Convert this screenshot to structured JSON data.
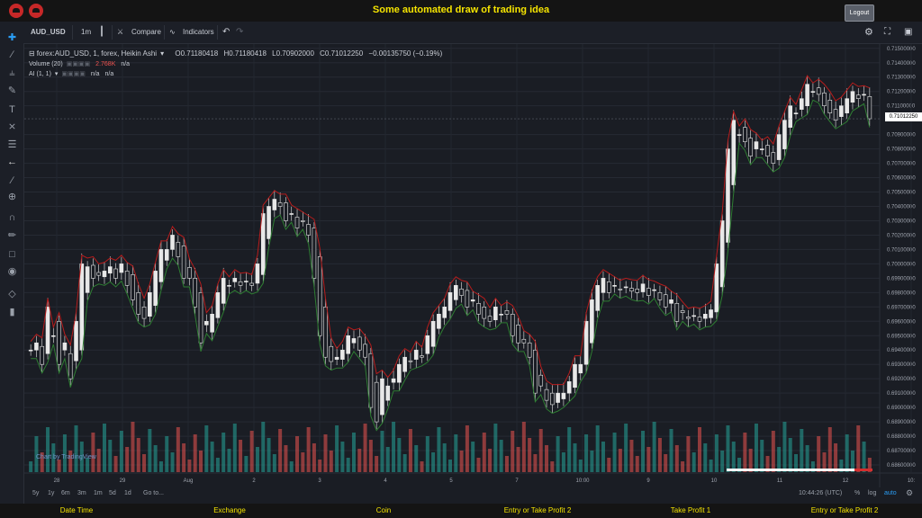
{
  "header": {
    "title": "Some automated draw of trading idea",
    "logout_label": "Logout"
  },
  "toolbar": {
    "symbol": "AUD_USD",
    "interval": "1m",
    "compare_label": "Compare",
    "indicators_label": "Indicators"
  },
  "legend": {
    "main_title": "forex:AUD_USD, 1, forex, Heikin Ashi",
    "open": "O0.71180418",
    "high": "H0.71180418",
    "low": "L0.70902000",
    "close": "C0.71012250",
    "change": "−0.00135750 (−0.19%)",
    "volume_label": "Volume (20)",
    "volume_value": "2.768K",
    "volume_na": "n/a",
    "ai_label": "AI (1, 1)",
    "ai_na1": "n/a",
    "ai_na2": "n/a"
  },
  "price_axis": {
    "ticks": [
      "0.71500000",
      "0.71400000",
      "0.71300000",
      "0.71200000",
      "0.71100000",
      "0.70900000",
      "0.70800000",
      "0.70700000",
      "0.70600000",
      "0.70500000",
      "0.70400000",
      "0.70300000",
      "0.70200000",
      "0.70100000",
      "0.70000000",
      "0.69900000",
      "0.69800000",
      "0.69700000",
      "0.69600000",
      "0.69500000",
      "0.69400000",
      "0.69300000",
      "0.69200000",
      "0.69100000",
      "0.69000000",
      "0.68900000",
      "0.68800000",
      "0.68700000",
      "0.68600000"
    ],
    "current_price": "0.71012250"
  },
  "time_axis": {
    "labels": [
      "28",
      "29",
      "Aug",
      "2",
      "3",
      "4",
      "5",
      "7",
      "10:00",
      "9",
      "10",
      "11",
      "12",
      "10:"
    ]
  },
  "timebar": {
    "ranges": [
      "5y",
      "1y",
      "6m",
      "3m",
      "1m",
      "5d",
      "1d"
    ],
    "goto_label": "Go to...",
    "clock": "10:44:26 (UTC)",
    "percent_label": "%",
    "log_label": "log",
    "auto_label": "auto"
  },
  "watermark": "Chart by TradingView",
  "footer": {
    "columns": [
      "Date Time",
      "Exchange",
      "Coin",
      "Entry or Take Profit 2",
      "Take Profit 1",
      "Entry or Take Profit 2"
    ]
  },
  "colors": {
    "background": "#1a1d24",
    "title": "#f5e400",
    "up": "#26a69a",
    "down": "#ef5350",
    "candle": "#e8e8e8",
    "ma_red": "#b71c1c",
    "ma_green": "#2e7d32"
  },
  "chart_data": {
    "type": "candlestick",
    "symbol": "AUD_USD",
    "ylim": [
      0.6855,
      0.7153
    ],
    "close_series": [
      0.694,
      0.6945,
      0.693,
      0.697,
      0.695,
      0.693,
      0.6945,
      0.692,
      0.696,
      0.7,
      0.6998,
      0.699,
      0.6992,
      0.6995,
      0.6998,
      0.699,
      0.7,
      0.6985,
      0.6975,
      0.6965,
      0.6962,
      0.698,
      0.6995,
      0.701,
      0.701,
      0.702,
      0.7005,
      0.699,
      0.699,
      0.697,
      0.6945,
      0.696,
      0.6965,
      0.698,
      0.699,
      0.6985,
      0.699,
      0.6985,
      0.6988,
      0.6985,
      0.7,
      0.7035,
      0.704,
      0.7045,
      0.704,
      0.703,
      0.7035,
      0.7025,
      0.703,
      0.702,
      0.699,
      0.695,
      0.6935,
      0.6932,
      0.6935,
      0.694,
      0.695,
      0.6948,
      0.694,
      0.6935,
      0.69,
      0.689,
      0.692,
      0.6915,
      0.692,
      0.693,
      0.6935,
      0.6932,
      0.694,
      0.6935,
      0.695,
      0.696,
      0.6965,
      0.697,
      0.698,
      0.6985,
      0.6978,
      0.697,
      0.6975,
      0.6965,
      0.6962,
      0.696,
      0.697,
      0.6965,
      0.6965,
      0.695,
      0.6945,
      0.6945,
      0.6935,
      0.691,
      0.6915,
      0.6905,
      0.6902,
      0.691,
      0.691,
      0.6918,
      0.693,
      0.693,
      0.696,
      0.6975,
      0.6985,
      0.699,
      0.698,
      0.6985,
      0.6982,
      0.6984,
      0.6981,
      0.698,
      0.6986,
      0.6978,
      0.6982,
      0.6975,
      0.697,
      0.6975,
      0.696,
      0.6966,
      0.6962,
      0.6964,
      0.696,
      0.6965,
      0.6968,
      0.7,
      0.703,
      0.708,
      0.71,
      0.709,
      0.7085,
      0.7075,
      0.7085,
      0.708,
      0.7075,
      0.707,
      0.709,
      0.71,
      0.711,
      0.7105,
      0.7115,
      0.7125,
      0.712,
      0.7118,
      0.711,
      0.7105,
      0.71,
      0.711,
      0.7115,
      0.712,
      0.7115,
      0.7118,
      0.7101
    ]
  }
}
